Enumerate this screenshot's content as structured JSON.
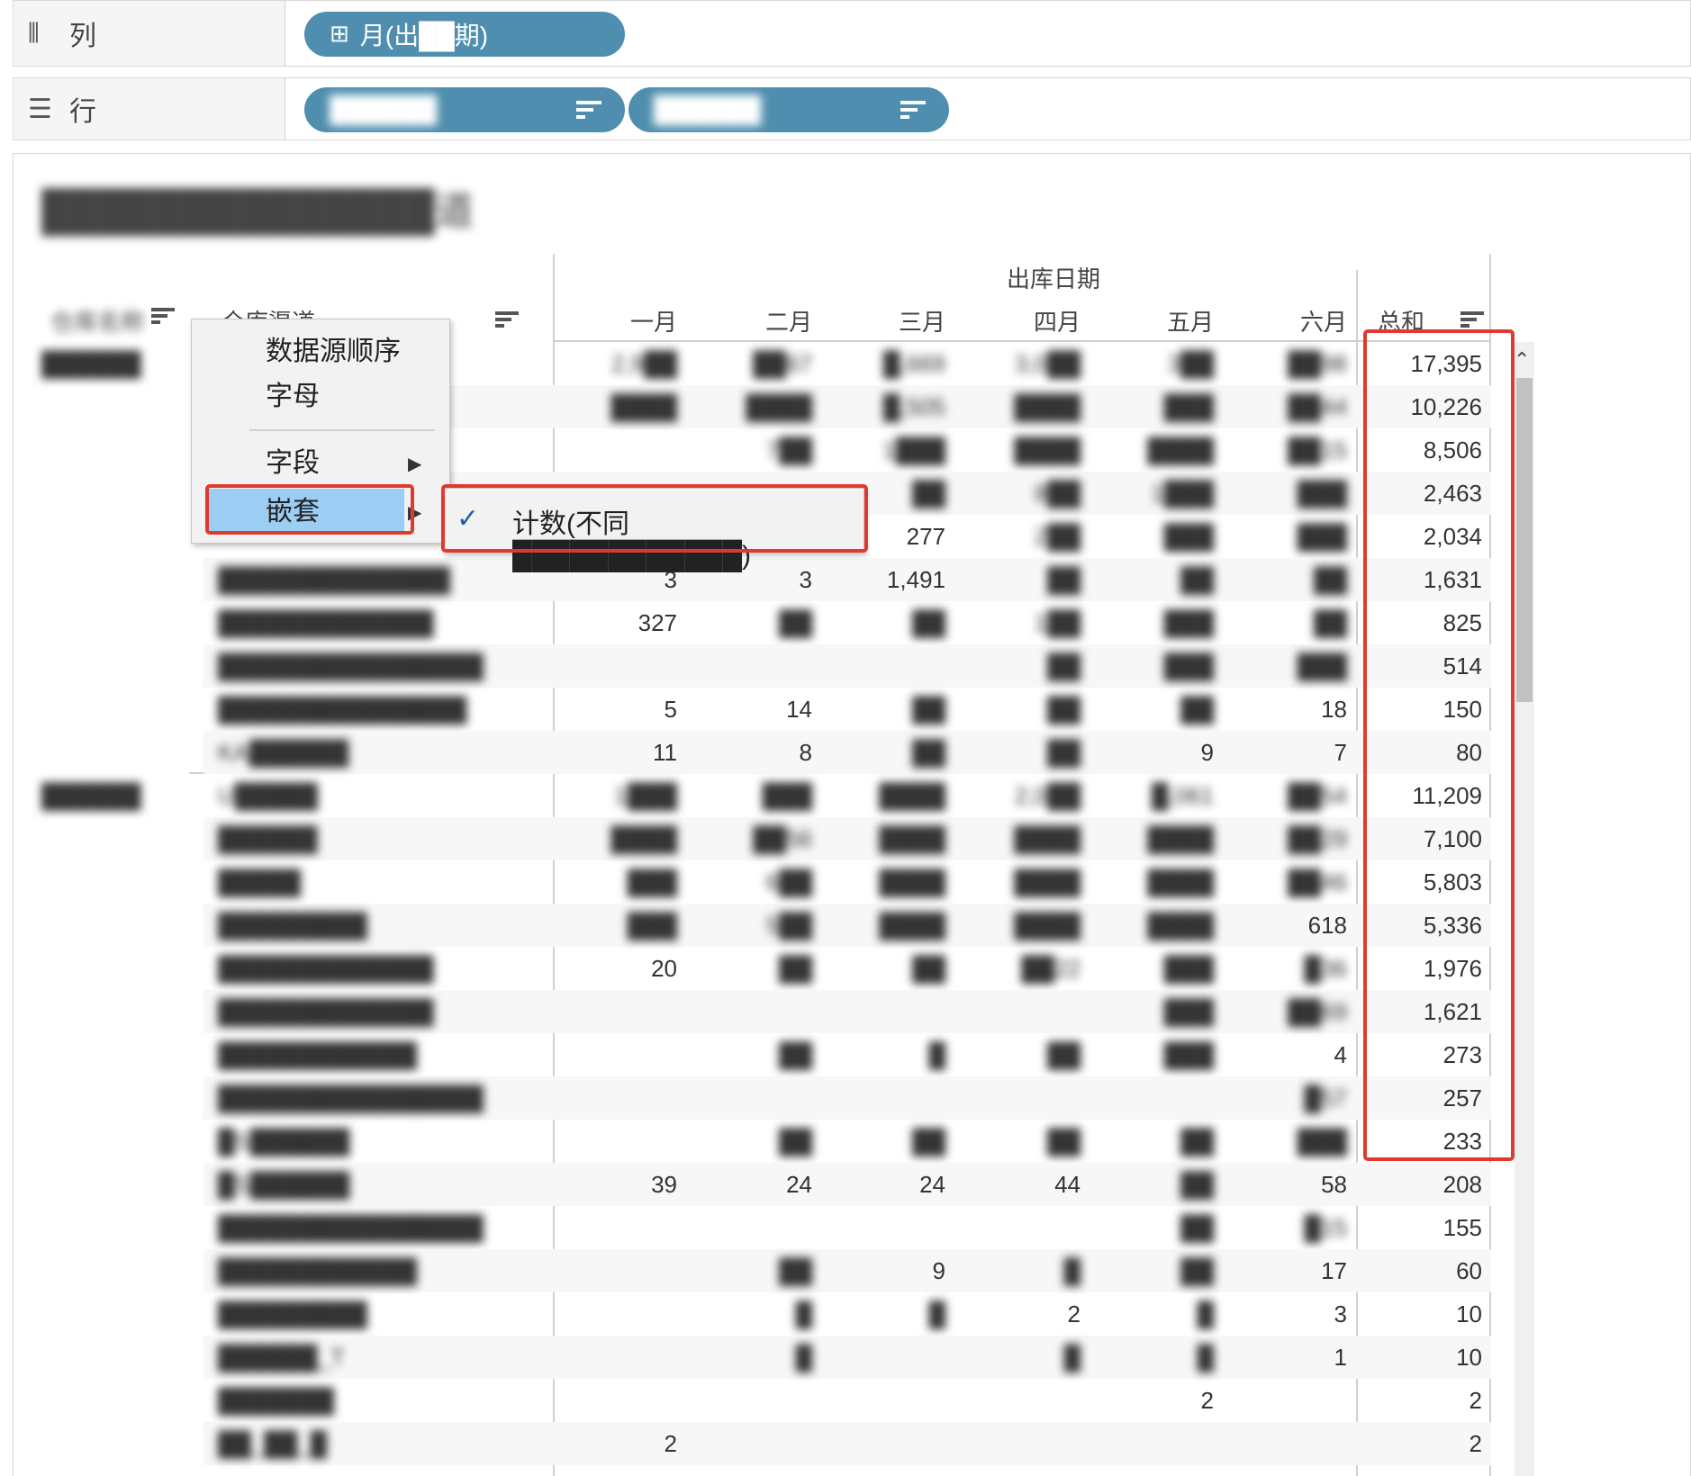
{
  "shelves": {
    "columns": {
      "icon": "columns-icon",
      "label": "列",
      "pill": {
        "icon": "plus-box-icon",
        "text": "月(出██期)"
      }
    },
    "rows": {
      "icon": "rows-icon",
      "label": "行",
      "pills": [
        {
          "text": "██████",
          "sort_icon": "sort-desc-icon"
        },
        {
          "text": "██████",
          "sort_icon": "sort-desc-icon"
        }
      ]
    }
  },
  "sheet": {
    "title": "██████████████道"
  },
  "table": {
    "row_header_1": "仓库名称",
    "row_header_2": "仓库渠道",
    "column_group": "出库日期",
    "months": [
      "一月",
      "二月",
      "三月",
      "四月",
      "五月",
      "六月"
    ],
    "total_label": "总和",
    "groups": [
      {
        "name": "██████",
        "rows": [
          {
            "name": "",
            "vals": [
              "2,9██",
              "██67",
              "█,669",
              "3,0██",
              "3██",
              "██98"
            ],
            "total": "17,395"
          },
          {
            "name": "",
            "vals": [
              "████",
              "████",
              "█,505",
              "████",
              "███",
              "██44"
            ],
            "total": "10,226"
          },
          {
            "name": "",
            "vals": [
              "",
              "7██",
              "1███",
              "████",
              "████",
              "██15"
            ],
            "total": "8,506"
          },
          {
            "name": "",
            "vals": [
              "",
              "",
              "██",
              "8██",
              "1███",
              "███"
            ],
            "total": "2,463"
          },
          {
            "name": "",
            "vals": [
              "",
              "",
              "277",
              "2██",
              "███",
              "███"
            ],
            "total": "2,034"
          },
          {
            "name": "██████████████",
            "vals": [
              "3",
              "3",
              "1,491",
              "██",
              "██",
              "██"
            ],
            "total": "1,631"
          },
          {
            "name": "█████████████",
            "vals": [
              "327",
              "██",
              "██",
              "1██",
              "███",
              "██"
            ],
            "total": "825"
          },
          {
            "name": "████████████████",
            "vals": [
              "",
              "",
              "",
              "██",
              "███",
              "███"
            ],
            "total": "514"
          },
          {
            "name": "███████████████",
            "vals": [
              "5",
              "14",
              "██",
              "██",
              "██",
              "18"
            ],
            "total": "150"
          },
          {
            "name": "KA██████",
            "vals": [
              "11",
              "8",
              "██",
              "██",
              "9",
              "7"
            ],
            "total": "80"
          }
        ]
      },
      {
        "name": "██████",
        "rows": [
          {
            "name": "U█████",
            "vals": [
              "1███",
              "███",
              "████",
              "2,0██",
              "█,061",
              "██54"
            ],
            "total": "11,209"
          },
          {
            "name": "██████",
            "vals": [
              "████",
              "██56",
              "████",
              "████",
              "████",
              "██29"
            ],
            "total": "7,100"
          },
          {
            "name": "█████",
            "vals": [
              "███",
              "6██",
              "████",
              "████",
              "████",
              "██46"
            ],
            "total": "5,803"
          },
          {
            "name": "█████████",
            "vals": [
              "███",
              "5██",
              "████",
              "████",
              "████",
              "618"
            ],
            "total": "5,336"
          },
          {
            "name": "█████████████",
            "vals": [
              "20",
              "██",
              "██",
              "██22",
              "███",
              "█36"
            ],
            "total": "1,976"
          },
          {
            "name": "█████████████",
            "vals": [
              "",
              "",
              "",
              "",
              "███",
              "██69"
            ],
            "total": "1,621"
          },
          {
            "name": "████████████",
            "vals": [
              "",
              "██",
              "█",
              "██",
              "███",
              "4"
            ],
            "total": "273"
          },
          {
            "name": "████████████████",
            "vals": [
              "",
              "",
              "",
              "",
              "",
              "█57"
            ],
            "total": "257"
          },
          {
            "name": "█S██████",
            "vals": [
              "",
              "██",
              "██",
              "██",
              "██",
              "███"
            ],
            "total": "233"
          },
          {
            "name": "█S██████",
            "vals": [
              "39",
              "24",
              "24",
              "44",
              "██",
              "58"
            ],
            "total": "208"
          },
          {
            "name": "████████████████",
            "vals": [
              "",
              "",
              "",
              "",
              "██",
              "█15"
            ],
            "total": "155"
          },
          {
            "name": "████████████",
            "vals": [
              "",
              "██",
              "9",
              "█",
              "██",
              "17"
            ],
            "total": "60"
          },
          {
            "name": "█████████",
            "vals": [
              "",
              "█",
              "█",
              "2",
              "█",
              "3"
            ],
            "total": "10"
          },
          {
            "name": "██████_T",
            "vals": [
              "",
              "█",
              "",
              "█",
              "█",
              "1"
            ],
            "total": "10"
          },
          {
            "name": "███████",
            "vals": [
              "",
              "",
              "",
              "",
              "2",
              ""
            ],
            "total": "2"
          },
          {
            "name": "██_██_█",
            "vals": [
              "2",
              "",
              "",
              "",
              "",
              ""
            ],
            "total": "2"
          }
        ]
      }
    ]
  },
  "sort_menu": {
    "items": [
      "数据源顺序",
      "字母",
      "字段",
      "嵌套"
    ],
    "selected": "嵌套",
    "submenu": {
      "check_icon": "check-icon",
      "text": "计数(不同████████████)"
    }
  },
  "icons": {
    "sort": "sort-desc-icon",
    "submenu_arrow": "chevron-right-icon",
    "scroll_up": "chevron-up-icon"
  },
  "colors": {
    "pill": "#4f8eae",
    "highlight": "#9ccdf3",
    "annotation": "#e03a2f"
  }
}
